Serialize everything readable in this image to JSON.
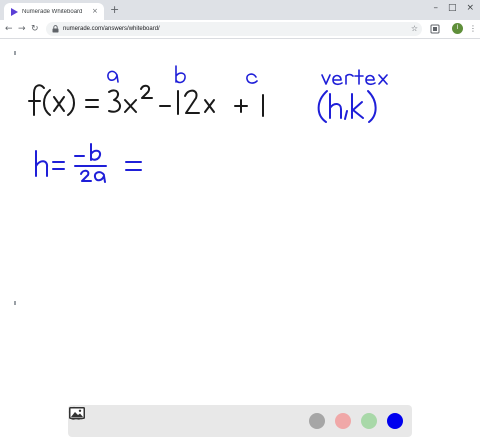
{
  "browser": {
    "tab_title": "Numerade Whiteboard",
    "tab_close": "×",
    "new_tab": "+",
    "url": "numerade.com/answers/whiteboard/",
    "profile_initial": "I",
    "window_controls": [
      "–",
      "□",
      "×"
    ],
    "nav": {
      "back": "←",
      "forward": "→",
      "reload": "↻",
      "star": "☆",
      "menu": "⋮"
    }
  },
  "whiteboard": {
    "equation": "f(x) = 3x^2 - 12x + 1",
    "coefficient_labels": [
      "a",
      "b",
      "c"
    ],
    "vertex_label": "vertex",
    "vertex_form": "(h,k)",
    "h_formula": "h = -b/2a ="
  },
  "toolbar": {
    "tools": [
      "undo-icon",
      "redo-icon",
      "pointer-icon",
      "pen-icon",
      "shapes-icon",
      "text-icon",
      "eraser-icon",
      "text-icon",
      "image-icon"
    ],
    "colors": [
      {
        "name": "gray",
        "hex": "#a6a6a6"
      },
      {
        "name": "pink",
        "hex": "#f0a8a8"
      },
      {
        "name": "green",
        "hex": "#a8d8a8"
      },
      {
        "name": "blue",
        "hex": "#0000ee"
      }
    ],
    "selected_color": "blue"
  }
}
